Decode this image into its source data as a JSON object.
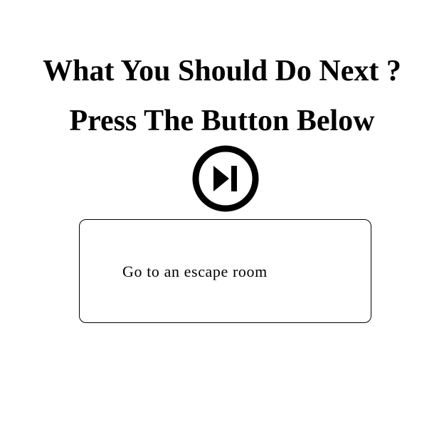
{
  "header": {
    "question": "What You Should Do Next ?",
    "instruction": "Press The Button Below"
  },
  "next_button": {
    "icon": "skip-next-icon",
    "color": "#000000"
  },
  "suggestion": {
    "text": "Go to an escape room"
  }
}
